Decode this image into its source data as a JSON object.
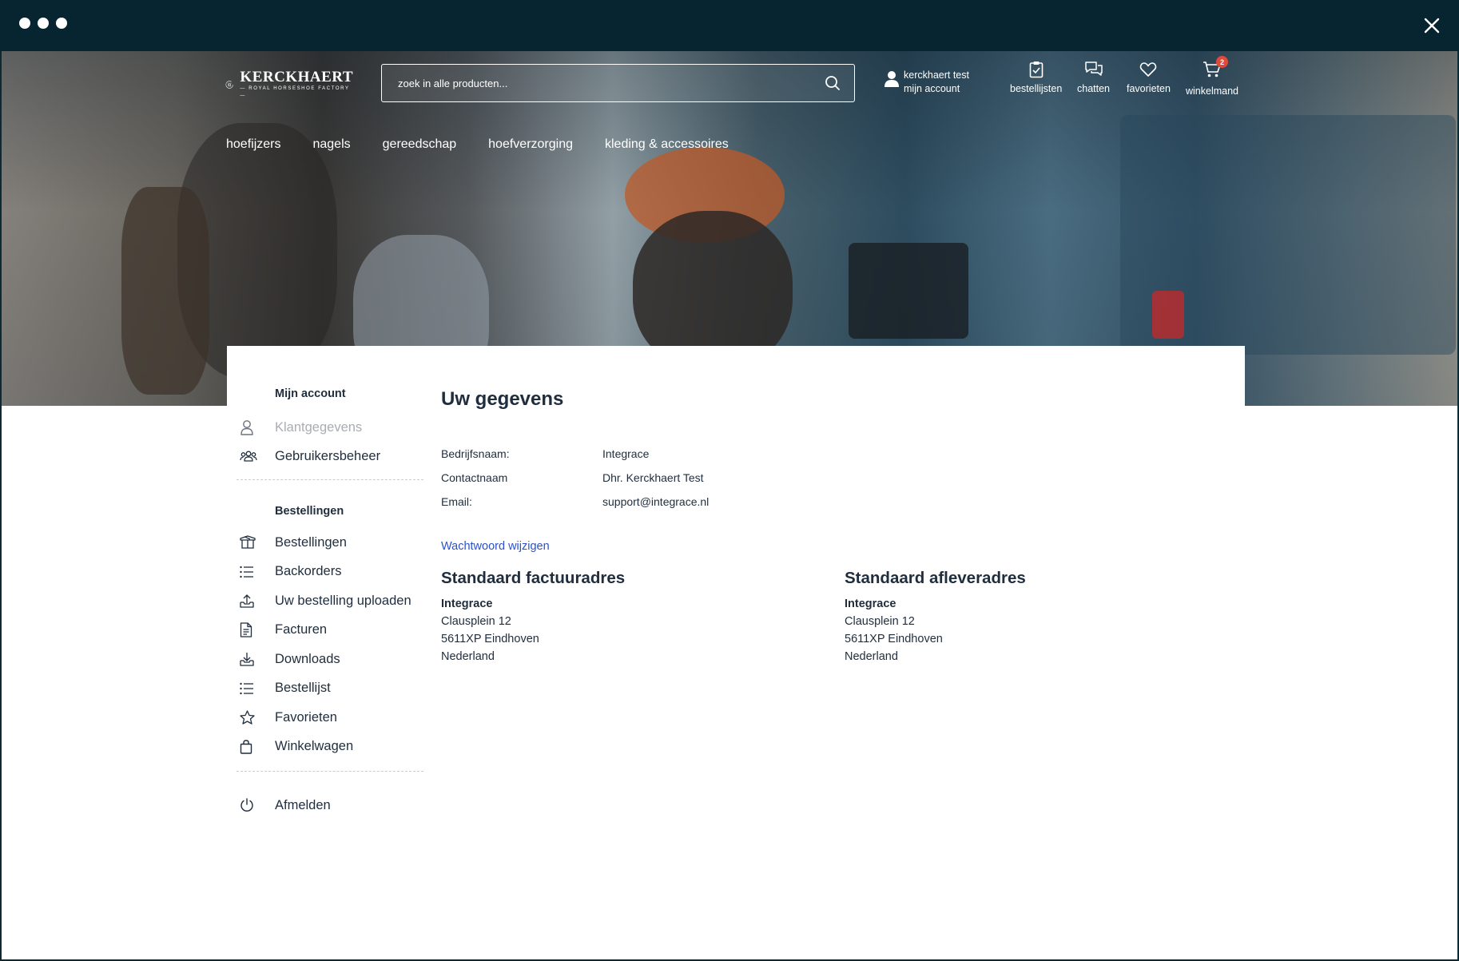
{
  "header": {
    "search_placeholder": "zoek in alle producten...",
    "account_name": "kerckhaert test",
    "account_link": "mijn account",
    "quick": {
      "bestellijsten": "bestellijsten",
      "chatten": "chatten",
      "favorieten": "favorieten",
      "winkelmand": "winkelmand",
      "cart_count": "2"
    }
  },
  "nav": [
    "hoefijzers",
    "nagels",
    "gereedschap",
    "hoefverzorging",
    "kleding & accessoires"
  ],
  "sidebar": {
    "account_heading": "Mijn account",
    "account_items": [
      {
        "label": "Klantgegevens",
        "icon": "user-icon"
      },
      {
        "label": "Gebruikersbeheer",
        "icon": "users-icon"
      }
    ],
    "orders_heading": "Bestellingen",
    "order_items": [
      {
        "label": "Bestellingen",
        "icon": "box-icon"
      },
      {
        "label": "Backorders",
        "icon": "list-icon"
      },
      {
        "label": "Uw bestelling uploaden",
        "icon": "upload-icon"
      },
      {
        "label": "Facturen",
        "icon": "document-icon"
      },
      {
        "label": "Downloads",
        "icon": "download-icon"
      },
      {
        "label": "Bestellijst",
        "icon": "list-icon"
      },
      {
        "label": "Favorieten",
        "icon": "star-icon"
      },
      {
        "label": "Winkelwagen",
        "icon": "bag-icon"
      }
    ],
    "logout": "Afmelden"
  },
  "main": {
    "title": "Uw gegevens",
    "fields": [
      {
        "label": "Bedrijfsnaam:",
        "value": "Integrace"
      },
      {
        "label": "Contactnaam",
        "value": "Dhr. Kerckhaert Test"
      },
      {
        "label": "Email:",
        "value": "support@integrace.nl"
      }
    ],
    "password_link": "Wachtwoord wijzigen",
    "billing": {
      "heading": "Standaard factuuradres",
      "name": "Integrace",
      "street": "Clausplein 12",
      "city": "5611XP Eindhoven",
      "country": "Nederland"
    },
    "shipping": {
      "heading": "Standaard afleveradres",
      "name": "Integrace",
      "street": "Clausplein 12",
      "city": "5611XP Eindhoven",
      "country": "Nederland"
    }
  },
  "colors": {
    "titlebar": "#062530",
    "text": "#1f2d3d",
    "link": "#2b52cc",
    "badge": "#e04a3a",
    "muted": "#a9adb3"
  }
}
